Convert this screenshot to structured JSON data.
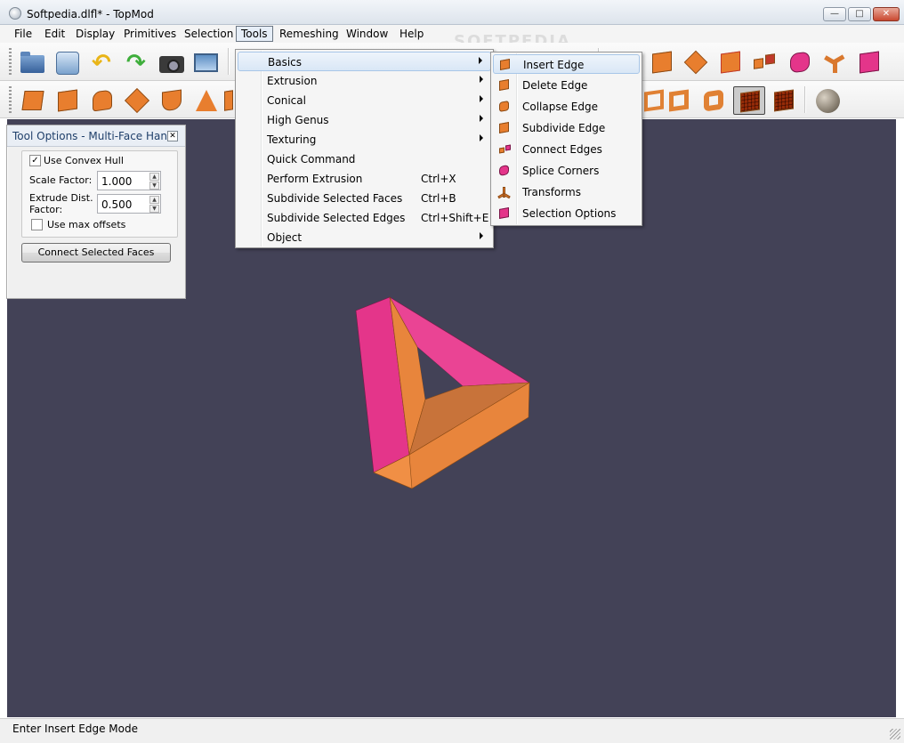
{
  "window": {
    "title": "Softpedia.dlfl* - TopMod"
  },
  "watermark": "SOFTPEDIA",
  "menubar": [
    {
      "label": "File"
    },
    {
      "label": "Edit"
    },
    {
      "label": "Display"
    },
    {
      "label": "Primitives"
    },
    {
      "label": "Selection"
    },
    {
      "label": "Tools"
    },
    {
      "label": "Remeshing"
    },
    {
      "label": "Window"
    },
    {
      "label": "Help"
    }
  ],
  "tools_menu": [
    {
      "label": "Basics",
      "shortcut": "",
      "submenu": true
    },
    {
      "label": "Extrusion",
      "shortcut": "",
      "submenu": true
    },
    {
      "label": "Conical",
      "shortcut": "",
      "submenu": true
    },
    {
      "label": "High Genus",
      "shortcut": "",
      "submenu": true
    },
    {
      "label": "Texturing",
      "shortcut": "",
      "submenu": true
    },
    {
      "label": "Quick Command",
      "shortcut": "",
      "submenu": false
    },
    {
      "label": "Perform Extrusion",
      "shortcut": "Ctrl+X",
      "submenu": false
    },
    {
      "label": "Subdivide Selected Faces",
      "shortcut": "Ctrl+B",
      "submenu": false
    },
    {
      "label": "Subdivide Selected Edges",
      "shortcut": "Ctrl+Shift+E",
      "submenu": false
    },
    {
      "label": "Object",
      "shortcut": "",
      "submenu": true
    }
  ],
  "basics_submenu": [
    {
      "label": "Insert Edge",
      "icon": "insert-edge-icon"
    },
    {
      "label": "Delete Edge",
      "icon": "delete-edge-icon"
    },
    {
      "label": "Collapse Edge",
      "icon": "collapse-edge-icon"
    },
    {
      "label": "Subdivide Edge",
      "icon": "subdivide-edge-icon"
    },
    {
      "label": "Connect Edges",
      "icon": "connect-edges-icon"
    },
    {
      "label": "Splice Corners",
      "icon": "splice-corners-icon"
    },
    {
      "label": "Transforms",
      "icon": "transforms-icon"
    },
    {
      "label": "Selection Options",
      "icon": "selection-options-icon"
    }
  ],
  "tool_options": {
    "title": "Tool Options - Multi-Face Han...",
    "use_convex_hull": {
      "label": "Use Convex Hull",
      "checked": true
    },
    "scale_factor": {
      "label": "Scale Factor:",
      "value": "1.000"
    },
    "extrude_dist": {
      "label_1": "Extrude Dist.",
      "label_2": "Factor:",
      "value": "0.500"
    },
    "use_max_offsets": {
      "label": "Use max offsets",
      "checked": false
    },
    "connect_button": "Connect Selected Faces"
  },
  "status": {
    "text": "Enter Insert Edge Mode"
  },
  "colors": {
    "viewport": "#434257",
    "orange": "#e8853c",
    "pink": "#e4358a"
  }
}
